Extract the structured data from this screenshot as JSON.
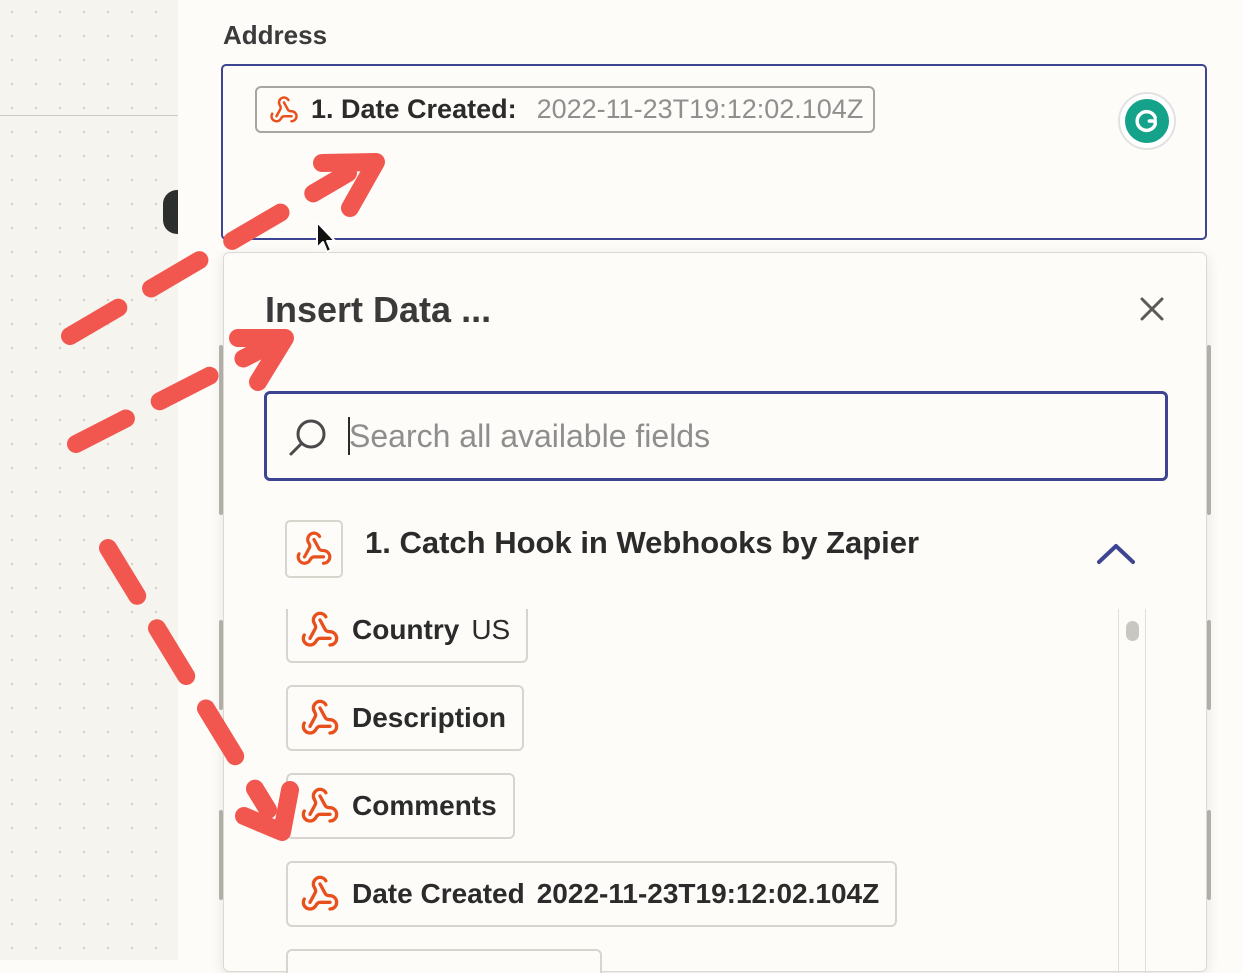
{
  "address": {
    "label": "Address",
    "token_key": "1. Date Created:",
    "token_value": "2022-11-23T19:12:02.104Z"
  },
  "icons": {
    "webhook": "webhook-icon",
    "grammarly": "grammarly-icon",
    "close": "close-icon",
    "search": "search-icon",
    "chevron": "chevron-up-icon"
  },
  "popover": {
    "title": "Insert Data ...",
    "search_placeholder": "Search all available fields",
    "group_title": "1. Catch Hook in Webhooks by Zapier",
    "items": [
      {
        "key": "Country",
        "value": "US"
      },
      {
        "key": "Description",
        "value": ""
      },
      {
        "key": "Comments",
        "value": ""
      },
      {
        "key": "Date Created",
        "value": "2022-11-23T19:12:02.104Z"
      }
    ]
  },
  "colors": {
    "accent": "#3d4592",
    "webhook": "#e8511e",
    "annotation_arrow": "#f2574f",
    "grammarly": "#15a28a"
  }
}
